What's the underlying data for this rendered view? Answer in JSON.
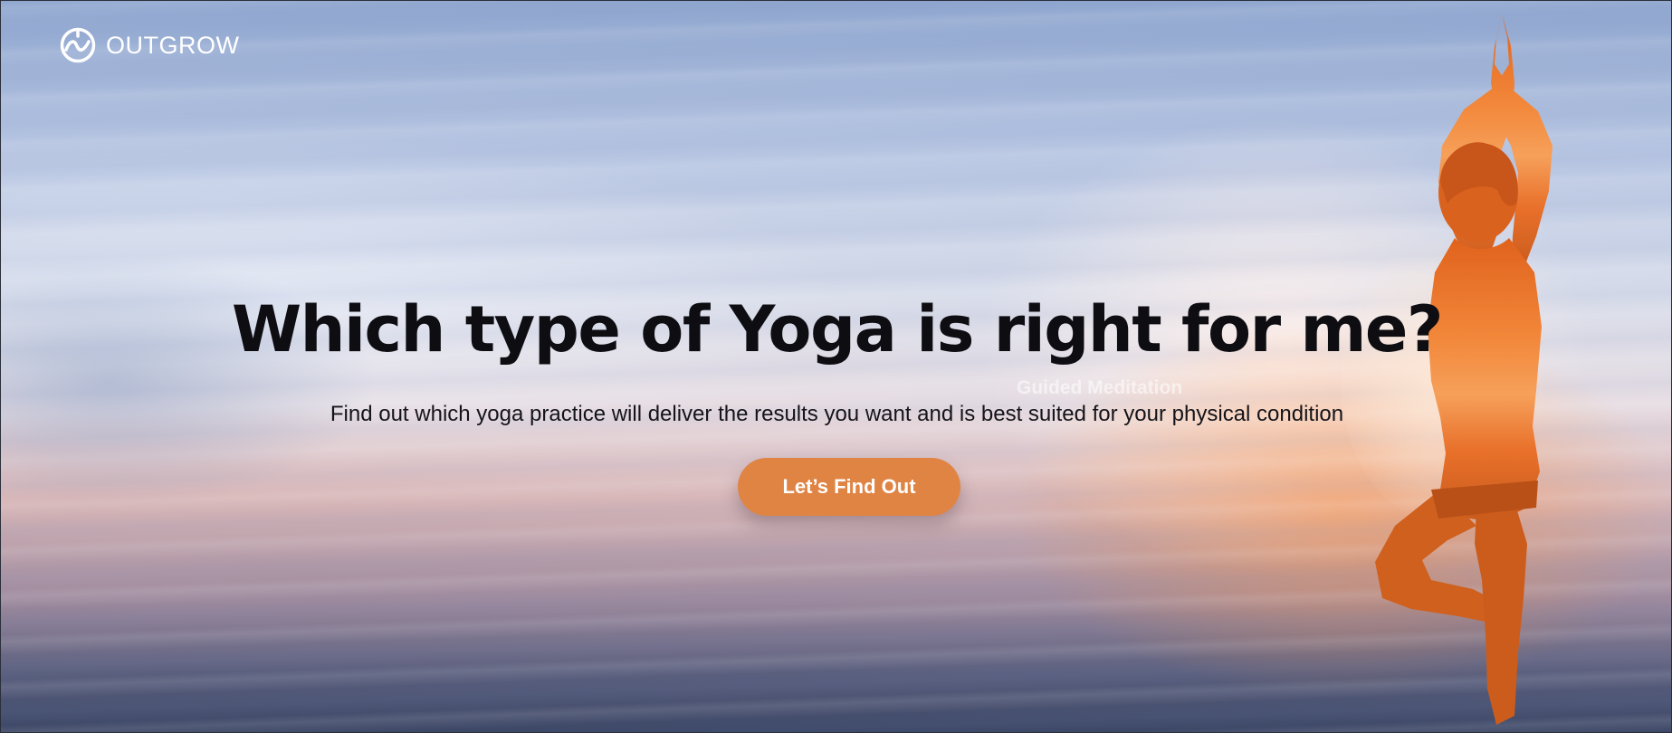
{
  "brand": {
    "name": "OUTGROW",
    "icon": "outgrow-logo-icon"
  },
  "hero": {
    "title": "Which type of Yoga is right for me?",
    "subtitle": "Find out which yoga practice will deliver the results you want and is best suited for your physical condition",
    "cta_label": "Let’s Find Out",
    "background_label": "Guided Meditation"
  },
  "colors": {
    "cta": "#e08444",
    "title": "#0d0d12",
    "logo": "#ffffff"
  }
}
